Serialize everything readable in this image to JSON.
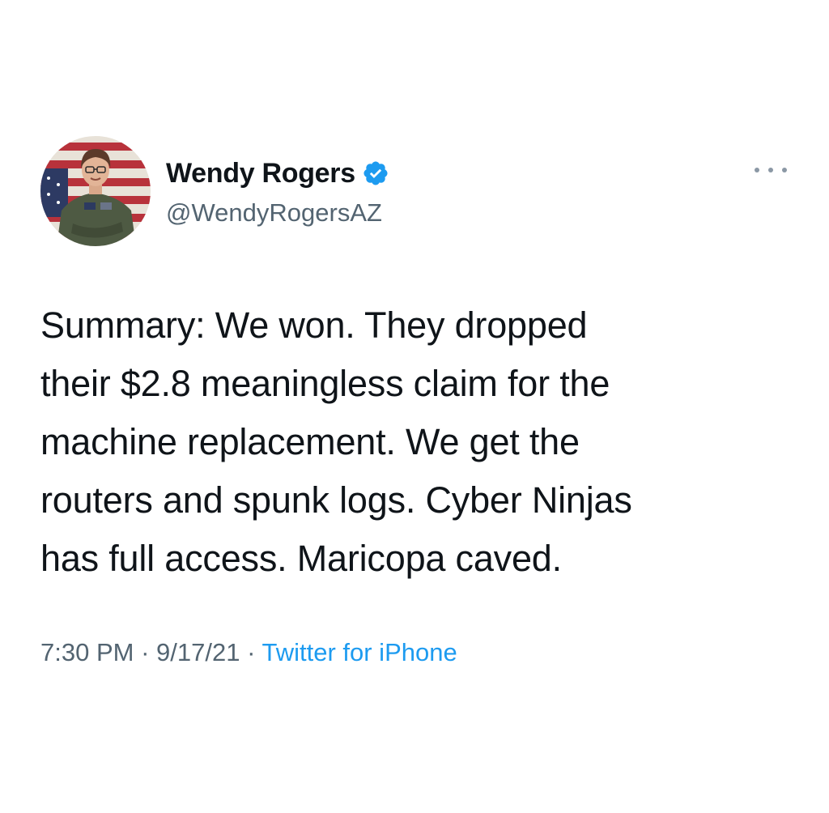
{
  "user": {
    "display_name": "Wendy Rogers",
    "handle": "@WendyRogersAZ",
    "verified": true,
    "avatar_icon": "profile-photo-flag-background"
  },
  "tweet": {
    "text_lines": [
      "Summary: We won. They dropped",
      "their $2.8 meaningless claim for the",
      "machine replacement. We get the",
      "routers and spunk logs. Cyber Ninjas",
      "has full access. Maricopa caved."
    ],
    "time": "7:30 PM",
    "separator": "·",
    "date": "9/17/21",
    "source": "Twitter for iPhone"
  },
  "icons": {
    "verified": "verified-badge-icon",
    "more": "more-options-icon"
  },
  "colors": {
    "text": "#0f1419",
    "secondary": "#536471",
    "link": "#1d9bf0",
    "verified": "#1d9bf0"
  }
}
